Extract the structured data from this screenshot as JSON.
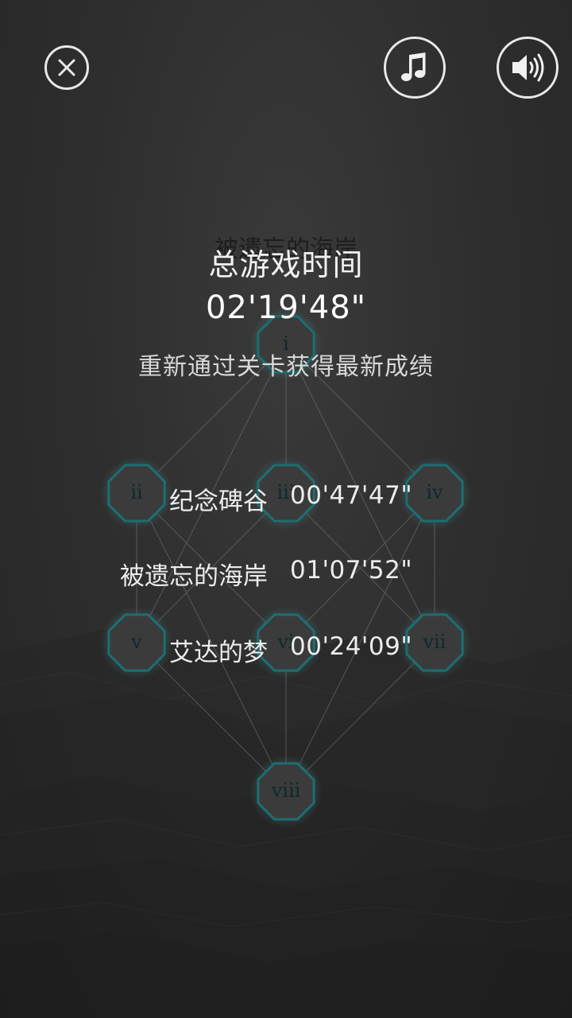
{
  "header": {
    "close_icon": "close-icon",
    "music_icon": "music-note-icon",
    "sound_icon": "speaker-icon"
  },
  "background_title": "被遗忘的海岸",
  "summary": {
    "total_label": "总游戏时间",
    "total_time": "02'19'48\"",
    "hint": "重新通过关卡获得最新成绩"
  },
  "level_map": {
    "nodes": [
      "i",
      "ii",
      "iii",
      "iv",
      "v",
      "vi",
      "vii",
      "viii"
    ]
  },
  "scores": [
    {
      "name": "纪念碑谷",
      "time": "00'47'47\""
    },
    {
      "name": "被遗忘的海岸",
      "time": "01'07'52\""
    },
    {
      "name": "艾达的梦",
      "time": "00'24'09\""
    }
  ],
  "colors": {
    "node_fill": "#3b3b3b",
    "node_stroke": "#1d6e72",
    "node_glow": "#4a8f92",
    "connector": "#8a8a8a"
  }
}
